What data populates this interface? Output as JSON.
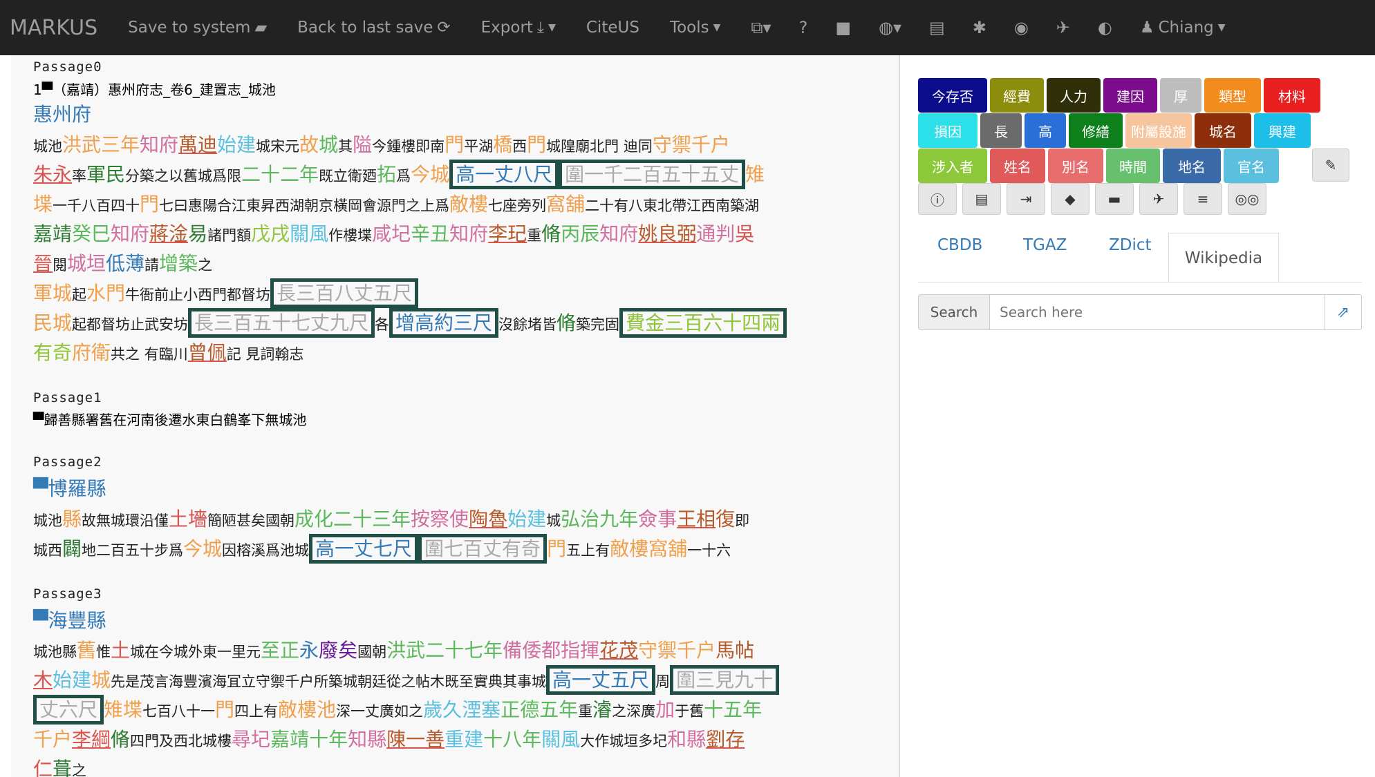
{
  "navbar": {
    "brand": "MARKUS",
    "save_label": "Save to system",
    "back_label": "Back to last save",
    "export_label": "Export",
    "citeus_label": "CiteUS",
    "tools_label": "Tools",
    "user_label": "Chiang"
  },
  "tags": {
    "row1": [
      "今存否",
      "經費",
      "人力",
      "建因",
      "厚",
      "類型",
      "材料"
    ],
    "row2": [
      "損因",
      "長",
      "高",
      "修繕",
      "附屬設施",
      "城名",
      "興建"
    ],
    "row3": [
      "涉入者",
      "姓名",
      "別名",
      "時間",
      "地名",
      "官名"
    ]
  },
  "tabs": {
    "cbdb": "CBDB",
    "tgaz": "TGAZ",
    "zdict": "ZDict",
    "wikipedia": "Wikipedia"
  },
  "search": {
    "label": "Search",
    "placeholder": "Search here"
  },
  "passages": {
    "p0": {
      "title": "Passage0",
      "header": "1▀（嘉靖）惠州府志_卷6_建置志_城池",
      "place": "惠州府",
      "l1": [
        [
          "城池",
          "s"
        ],
        [
          "洪武三年",
          "l o"
        ],
        [
          "知府",
          "l p"
        ],
        [
          "萬迪",
          "l br u"
        ],
        [
          "始建",
          "l lb"
        ],
        [
          "城",
          "s"
        ],
        [
          "宋元",
          "s"
        ],
        [
          "故",
          "l o"
        ],
        [
          "城",
          "l g"
        ],
        [
          "其",
          "s"
        ],
        [
          "隘",
          "l p"
        ],
        [
          "今鍾樓即南",
          "s"
        ],
        [
          "門",
          "l o"
        ],
        [
          "平湖",
          "s"
        ],
        [
          "橋",
          "l o"
        ],
        [
          "西",
          "s"
        ],
        [
          "門",
          "l o"
        ],
        [
          "城隍廟北門 迪同",
          "s"
        ],
        [
          "守禦千户",
          "l o"
        ]
      ],
      "l2": [
        [
          "朱永",
          "l r u"
        ],
        [
          "率",
          "s"
        ],
        [
          "軍民",
          "l dk"
        ],
        [
          "分築之以舊城爲限",
          "s"
        ],
        [
          "二十二年",
          "l g"
        ],
        [
          "既立衛廼",
          "s"
        ],
        [
          "拓",
          "l g"
        ],
        [
          "爲",
          "s"
        ],
        [
          "今城",
          "l o"
        ],
        [
          "高一丈八尺",
          "l b boxed"
        ],
        [
          "圍一千二百五十五丈",
          "l gy boxed"
        ],
        [
          "雉",
          "l o"
        ]
      ],
      "l3": [
        [
          "堞",
          "l o"
        ],
        [
          "一千八百四十",
          "s"
        ],
        [
          "門",
          "l o"
        ],
        [
          "七曰惠陽合江東昇西湖朝京橫岡會源門之上爲",
          "s"
        ],
        [
          "敵樓",
          "l o"
        ],
        [
          "七座旁列",
          "s"
        ],
        [
          "窩舖",
          "l o"
        ],
        [
          "二十有八東北帶江西南築湖",
          "s"
        ]
      ],
      "l4": [
        [
          "嘉靖",
          "l dk"
        ],
        [
          "癸巳",
          "l g"
        ],
        [
          "知府",
          "l p"
        ],
        [
          "蔣淦",
          "l br u"
        ],
        [
          "易",
          "l dk"
        ],
        [
          "諸門額",
          "s"
        ],
        [
          "戊戌",
          "l gr"
        ],
        [
          "關",
          "l lb"
        ],
        [
          "風",
          "l lb"
        ],
        [
          "作樓堞",
          "s"
        ],
        [
          "咸",
          "l p"
        ],
        [
          "圮",
          "l p"
        ],
        [
          "辛丑",
          "l g"
        ],
        [
          "知府",
          "l p"
        ],
        [
          "李玘",
          "l br u"
        ],
        [
          "重",
          "s"
        ],
        [
          "脩",
          "l dk"
        ],
        [
          "丙辰",
          "l g"
        ],
        [
          "知府",
          "l p"
        ],
        [
          "姚良弼",
          "l br u"
        ],
        [
          "通判",
          "l p"
        ],
        [
          "吳",
          "l r"
        ]
      ],
      "l5": [
        [
          "晉",
          "l r u"
        ],
        [
          "閱",
          "s"
        ],
        [
          "城垣",
          "l p"
        ],
        [
          "低薄",
          "l b"
        ],
        [
          "請",
          "s"
        ],
        [
          "增築",
          "l g"
        ],
        [
          "之",
          "s"
        ]
      ],
      "l6": [
        [
          "軍城",
          "l o"
        ],
        [
          "起",
          "s"
        ],
        [
          "水門",
          "l o"
        ],
        [
          "牛衙前止小西門都督坊",
          "s"
        ],
        [
          "長三百八丈五尺",
          "l gy boxed"
        ]
      ],
      "l7": [
        [
          "民城",
          "l o"
        ],
        [
          "起都督坊止武安坊",
          "s"
        ],
        [
          "長三百五十七丈九尺",
          "l gy boxed"
        ],
        [
          "各",
          "s"
        ],
        [
          "增高約三尺",
          "l b boxed"
        ],
        [
          "沒餘堵皆",
          "s"
        ],
        [
          "脩",
          "l dk"
        ],
        [
          "築完固",
          "s"
        ],
        [
          "費金三百六十四兩",
          "l gr boxed"
        ]
      ],
      "l8": [
        [
          "有奇",
          "l gr"
        ],
        [
          "府衛",
          "l o"
        ],
        [
          "共之 有臨川",
          "s"
        ],
        [
          "曾佩",
          "l br u"
        ],
        [
          "記 見詞翰志",
          "s"
        ]
      ]
    },
    "p1": {
      "title": "Passage1",
      "header": "▀歸善縣署舊在河南後遷水東白鶴峯下無城池"
    },
    "p2": {
      "title": "Passage2",
      "place": "▀博羅縣",
      "l1": [
        [
          "城池",
          "s"
        ],
        [
          "縣",
          "l o"
        ],
        [
          "故無城環沿僅",
          "s"
        ],
        [
          "土墻",
          "l r"
        ],
        [
          "簡陋甚矣國朝",
          "s"
        ],
        [
          "成化二十三年",
          "l g"
        ],
        [
          "按察使",
          "l p"
        ],
        [
          "陶魯",
          "l br u"
        ],
        [
          "始建",
          "l lb"
        ],
        [
          "城",
          "s"
        ],
        [
          "弘治九年",
          "l g"
        ],
        [
          "僉事",
          "l p"
        ],
        [
          "王相",
          "l br u"
        ],
        [
          "復",
          "l br"
        ],
        [
          "即",
          "s"
        ]
      ],
      "l2": [
        [
          "城西",
          "s"
        ],
        [
          "闢",
          "l dk"
        ],
        [
          "地二百五十步爲",
          "s"
        ],
        [
          "今城",
          "l o"
        ],
        [
          "因榕溪爲池城",
          "s"
        ],
        [
          "高一丈七尺",
          "l b boxed"
        ],
        [
          "圍七百丈有奇",
          "l gy boxed"
        ],
        [
          "門",
          "l o"
        ],
        [
          "五上有",
          "s"
        ],
        [
          "敵樓窩舖",
          "l o"
        ],
        [
          "一十六",
          "s"
        ]
      ]
    },
    "p3": {
      "title": "Passage3",
      "place": "▀海豐縣",
      "l1": [
        [
          "城池縣",
          "s"
        ],
        [
          "舊",
          "l o"
        ],
        [
          "惟",
          "s"
        ],
        [
          "土",
          "l r"
        ],
        [
          "城在今城外東一里元",
          "s"
        ],
        [
          "至正",
          "l g"
        ],
        [
          "永",
          "l b"
        ],
        [
          "廢矣",
          "l pu"
        ],
        [
          "國朝",
          "s"
        ],
        [
          "洪武二十七年",
          "l g"
        ],
        [
          "備倭都指揮",
          "l p"
        ],
        [
          "花茂",
          "l br u"
        ],
        [
          "守禦千户",
          "l o"
        ],
        [
          "馬帖",
          "l br"
        ]
      ],
      "l2": [
        [
          "木",
          "l r u"
        ],
        [
          "始建",
          "l lb"
        ],
        [
          "城",
          "l o"
        ],
        [
          "先是茂言海豐濱海冝立守禦千户所築城朝廷從之帖木既至實典其事城",
          "s"
        ],
        [
          "高一丈五尺",
          "l b boxed"
        ],
        [
          "周",
          "s"
        ],
        [
          "圍三見九十",
          "l gy boxed"
        ]
      ],
      "l3": [
        [
          "丈六尺",
          "l gy boxed"
        ],
        [
          "雉堞",
          "l o"
        ],
        [
          "七百八十一",
          "s"
        ],
        [
          "門",
          "l o"
        ],
        [
          "四上有",
          "s"
        ],
        [
          "敵樓池",
          "l o"
        ],
        [
          "深一丈廣如之",
          "s"
        ],
        [
          "歲久湮塞",
          "l lb"
        ],
        [
          "正德五年",
          "l g"
        ],
        [
          "重",
          "s"
        ],
        [
          "濬",
          "l dk"
        ],
        [
          "之深廣",
          "s"
        ],
        [
          "加",
          "l p"
        ],
        [
          "于舊",
          "s"
        ],
        [
          "十五年",
          "l g"
        ]
      ],
      "l4": [
        [
          "千户",
          "l o"
        ],
        [
          "李綱",
          "l r u"
        ],
        [
          "脩",
          "l dk"
        ],
        [
          "四門及西北城樓",
          "s"
        ],
        [
          "尋圮",
          "l p"
        ],
        [
          "嘉靖十年",
          "l g"
        ],
        [
          "知縣",
          "l p"
        ],
        [
          "陳一善",
          "l br u"
        ],
        [
          "重建",
          "l lb"
        ],
        [
          "十八年",
          "l g"
        ],
        [
          "關",
          "l lb"
        ],
        [
          "風",
          "l lb"
        ],
        [
          "大作城垣多圮",
          "s"
        ],
        [
          "和縣",
          "l p"
        ],
        [
          "劉存",
          "l br u"
        ]
      ],
      "l5": [
        [
          "仁",
          "l r"
        ],
        [
          "葺",
          "l dk"
        ],
        [
          "之",
          "s"
        ]
      ]
    }
  }
}
